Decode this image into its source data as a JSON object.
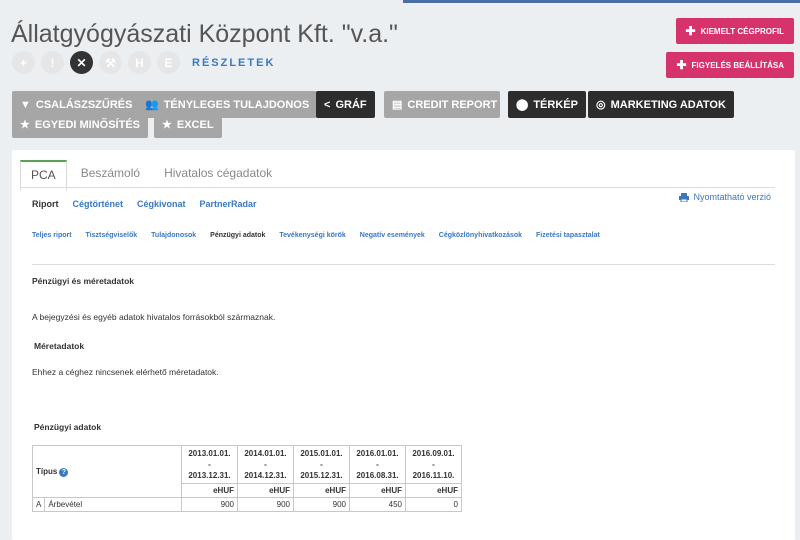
{
  "company_title": "Állatgyógyászati Központ Kft. \"v.a.\"",
  "status_icons": [
    {
      "label": "+",
      "icon": "plus-icon"
    },
    {
      "label": "!",
      "icon": "exclamation-icon"
    },
    {
      "label": "✕",
      "icon": "close-icon"
    },
    {
      "label": "⚒",
      "icon": "gavel-icon"
    },
    {
      "label": "H",
      "icon": "h-letter-icon"
    },
    {
      "label": "E",
      "icon": "e-letter-icon"
    }
  ],
  "reszletek_link": "RÉSZLETEK",
  "right_buttons": {
    "kiemelt": "KIEMELT CÉGPROFIL",
    "figyeles": "FIGYELÉS BEÁLLÍTÁSA"
  },
  "toolbar": {
    "csaladszures": "CSALÁSZSZŰRÉS",
    "tenyleges": "TÉNYLEGES TULAJDONOS",
    "graf": "GRÁF",
    "credit": "CREDIT REPORT",
    "terkep": "TÉRKÉP",
    "marketing": "MARKETING ADATOK",
    "egyedi": "EGYEDI MINŐSÍTÉS",
    "excel": "EXCEL"
  },
  "tabs": [
    "PCA",
    "Beszámoló",
    "Hivatalos cégadatok"
  ],
  "subnav": [
    "Riport",
    "Cégtörténet",
    "Cégkivonat",
    "PartnerRadar"
  ],
  "print_link": "Nyomtatható verzió",
  "subnav2": [
    "Teljes riport",
    "Tisztségviselők",
    "Tulajdonosok",
    "Pénzügyi adatok",
    "Tevékenységi körök",
    "Negatív események",
    "Cégközlönyhivatkozások",
    "Fizetési tapasztalat"
  ],
  "content": {
    "section_title": "Pénzügyi és méretadatok",
    "source_note": "A bejegyzési és egyéb adatok hivatalos forrásokból származnak.",
    "size_title": "Méretadatok",
    "size_note": "Ehhez a céghez nincsenek elérhető méretadatok.",
    "fin_title": "Pénzügyi adatok"
  },
  "table": {
    "type_label": "Típus",
    "periods": [
      {
        "from": "2013.01.01.",
        "to": "2013.12.31."
      },
      {
        "from": "2014.01.01.",
        "to": "2014.12.31."
      },
      {
        "from": "2015.01.01.",
        "to": "2015.12.31."
      },
      {
        "from": "2016.01.01.",
        "to": "2016.08.31."
      },
      {
        "from": "2016.09.01.",
        "to": "2016.11.10."
      }
    ],
    "dash": "-",
    "unit": "eHUF",
    "rows": [
      {
        "code": "A",
        "name": "Árbevétel",
        "values": [
          "900",
          "900",
          "900",
          "450",
          "0"
        ]
      }
    ]
  }
}
